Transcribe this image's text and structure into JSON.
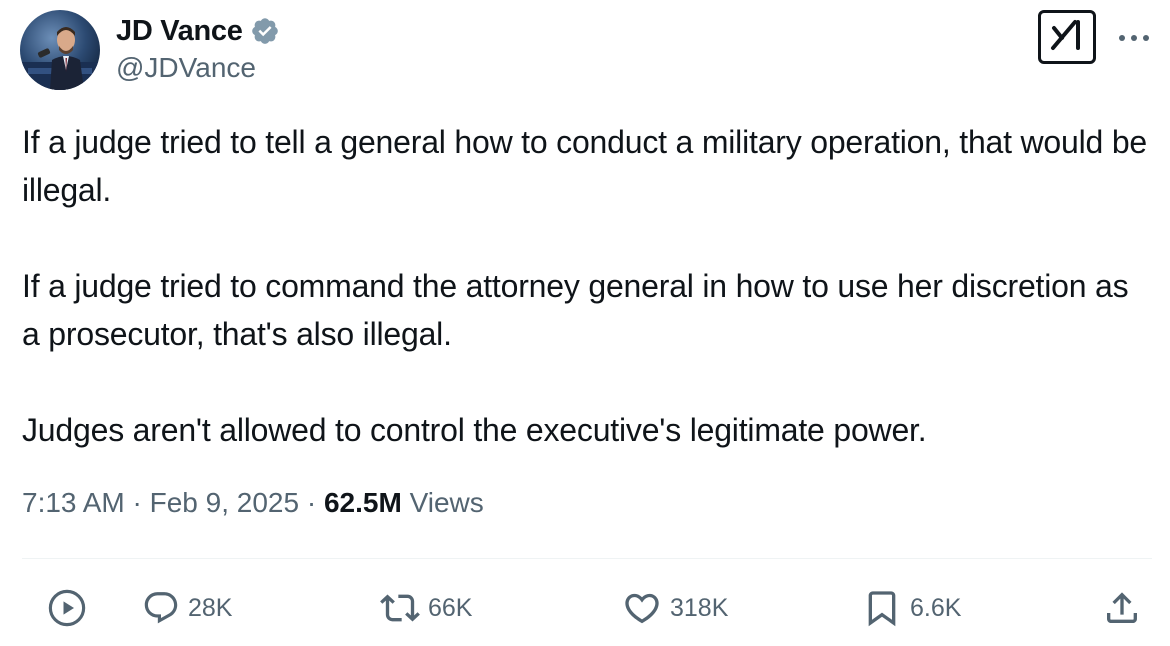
{
  "author": {
    "display_name": "JD Vance",
    "handle": "@JDVance",
    "verified_icon": "verified-badge-icon",
    "verified_color": "#829aab"
  },
  "header_actions": {
    "grok_icon": "grok-icon",
    "more_icon": "more-dots-icon"
  },
  "tweet": {
    "paragraphs": [
      "If a judge tried to tell a general how to conduct a military operation, that would be illegal.",
      "If a judge tried to command the attorney general in how to use her discretion as a prosecutor, that's also illegal.",
      "Judges aren't allowed to control the executive's legitimate power."
    ],
    "time": "7:13 AM",
    "separator": "·",
    "date": "Feb 9, 2025",
    "views_count": "62.5M",
    "views_label": "Views"
  },
  "actions": {
    "play_icon": "play-icon",
    "replies": {
      "icon": "reply-icon",
      "count": "28K"
    },
    "reposts": {
      "icon": "repost-icon",
      "count": "66K"
    },
    "likes": {
      "icon": "heart-icon",
      "count": "318K"
    },
    "bookmarks": {
      "icon": "bookmark-icon",
      "count": "6.6K"
    },
    "share_icon": "share-icon"
  },
  "colors": {
    "text_primary": "#0f1419",
    "text_secondary": "#536471",
    "divider": "#eff3f4"
  }
}
